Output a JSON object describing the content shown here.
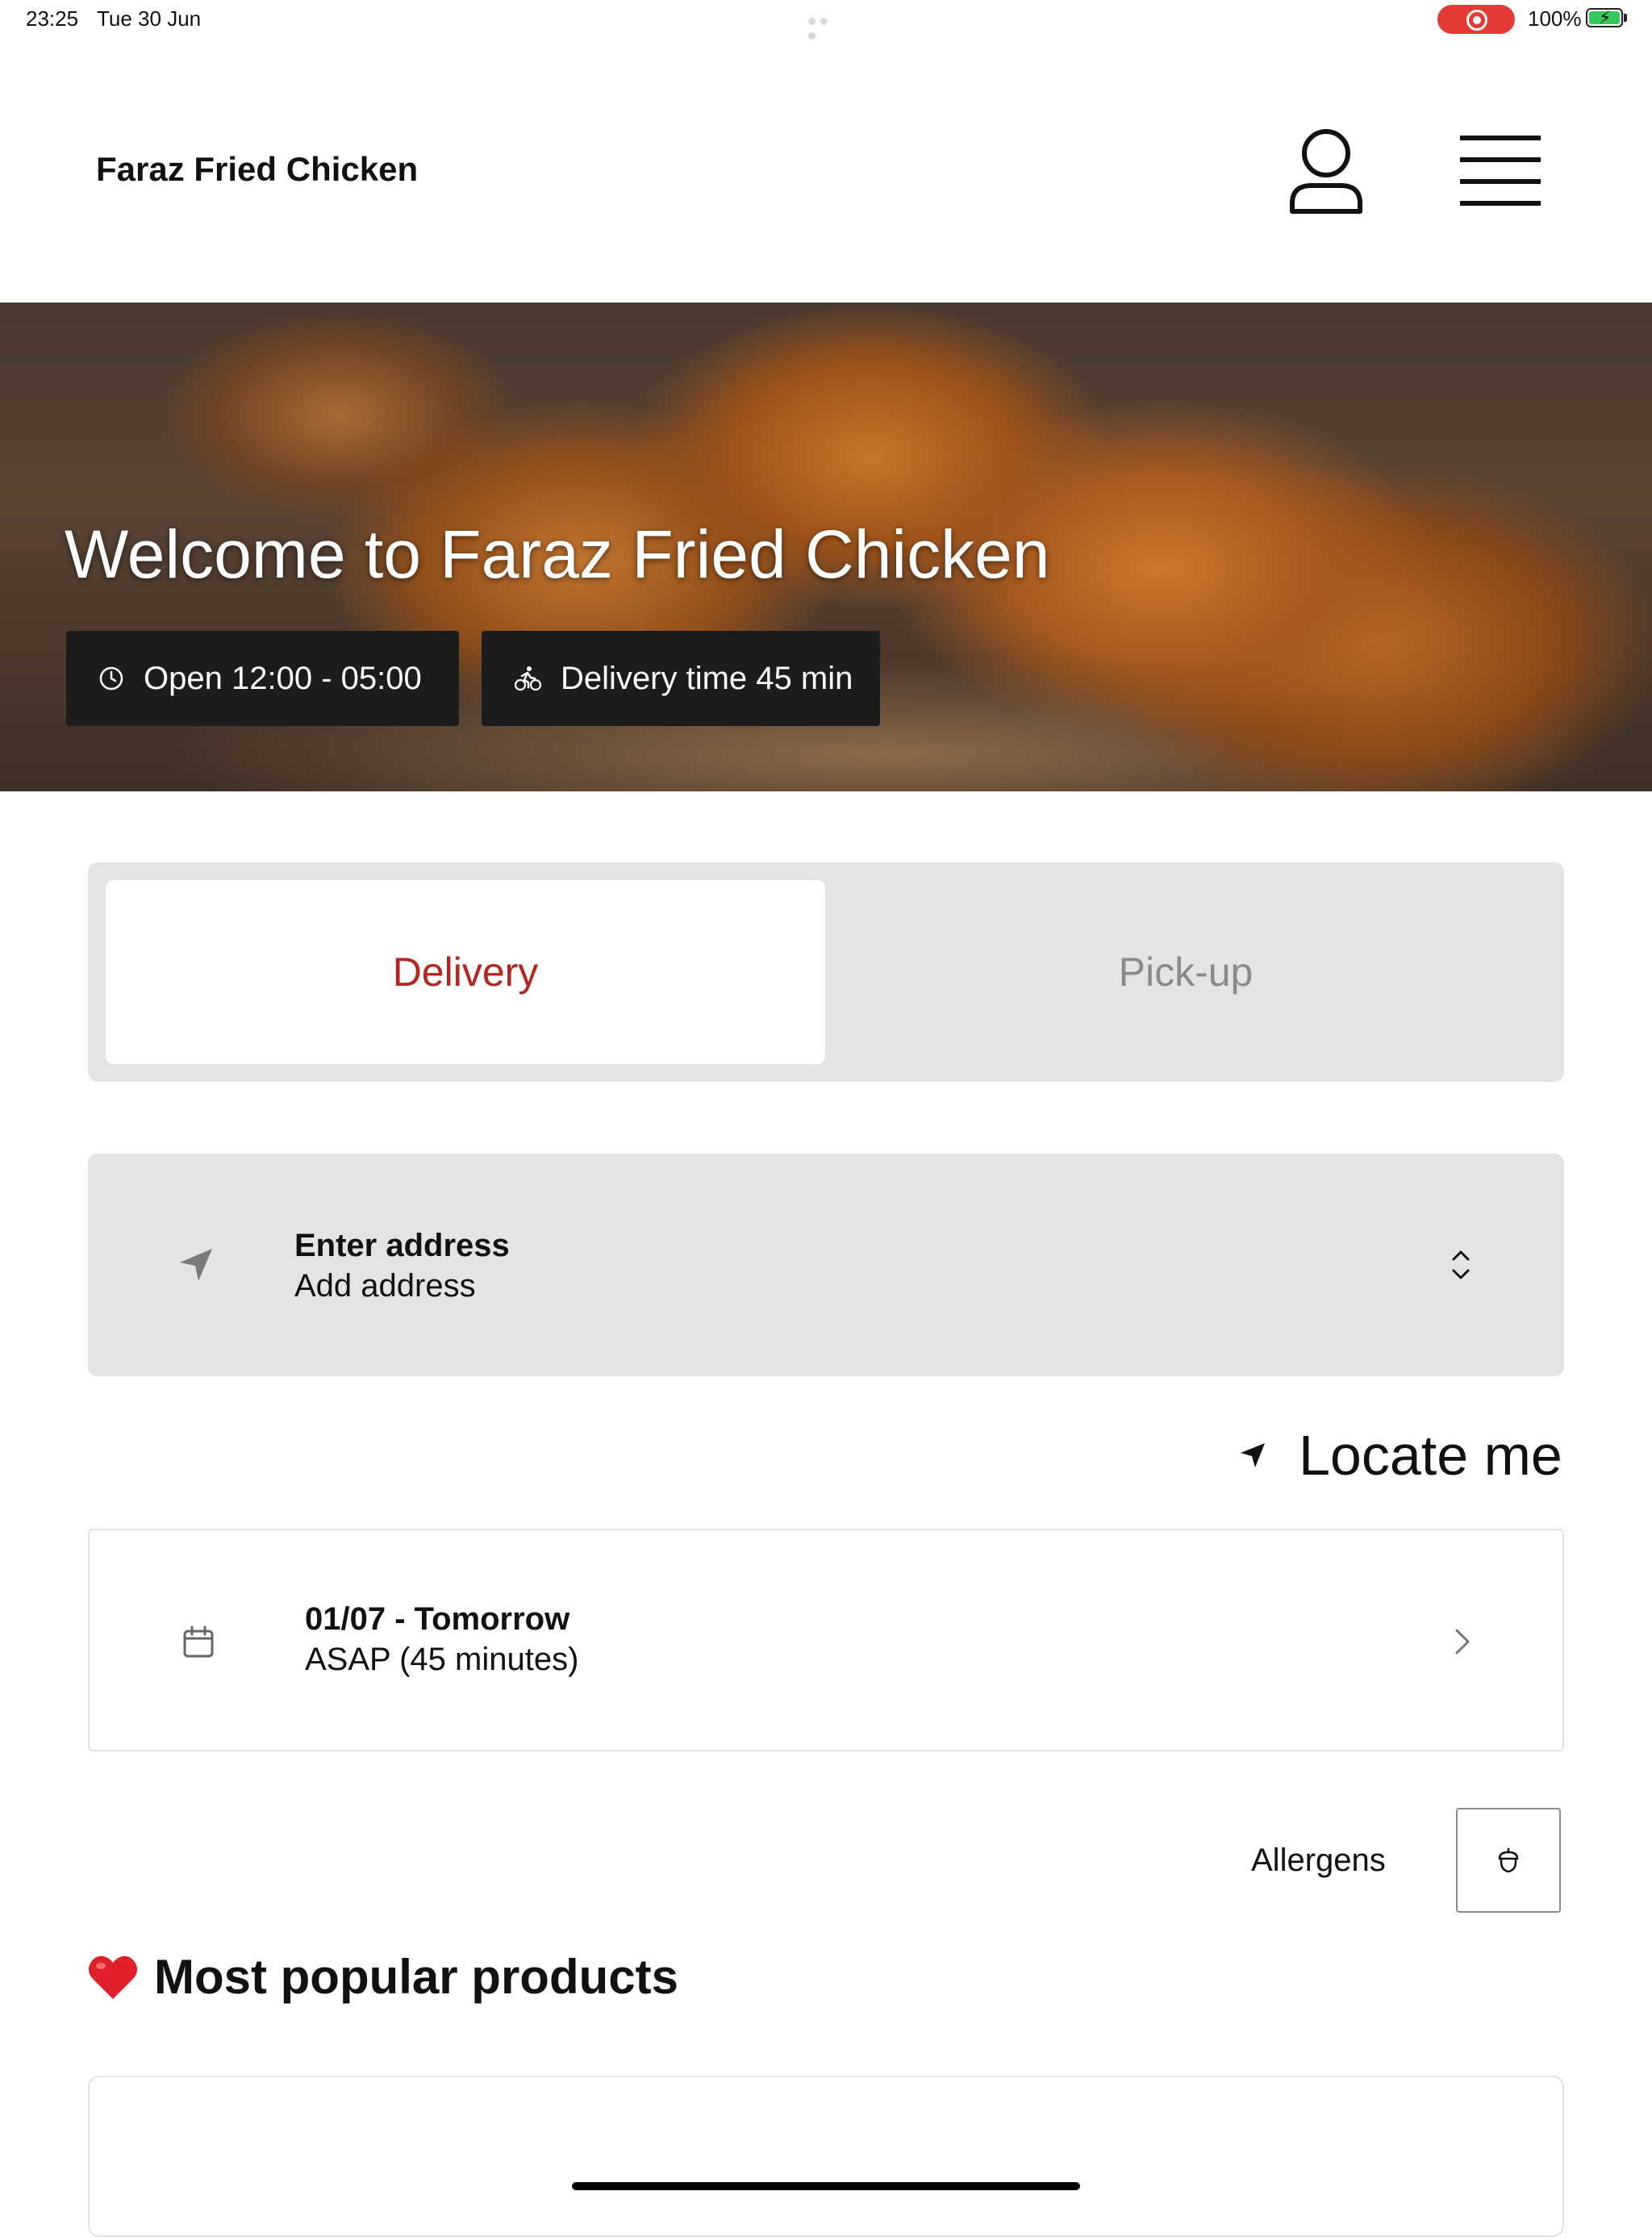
{
  "status_bar": {
    "time": "23:25",
    "date": "Tue 30 Jun",
    "battery_percent": "100%",
    "recording_color": "#e53935",
    "battery_color": "#34c759"
  },
  "header": {
    "brand": "Faraz Fried Chicken",
    "user_icon": "user-icon",
    "menu_icon": "hamburger-menu-icon"
  },
  "hero": {
    "title": "Welcome to Faraz Fried Chicken",
    "open_hours": "Open 12:00 - 05:00",
    "delivery_time": "Delivery time 45 min",
    "open_icon": "clock-icon",
    "delivery_icon": "cyclist-icon"
  },
  "order_mode": {
    "options": [
      "Delivery",
      "Pick-up"
    ],
    "selected": "Delivery",
    "active_color": "#b3261e"
  },
  "address": {
    "title": "Enter address",
    "placeholder": "Add address",
    "icon": "location-arrow-icon"
  },
  "locate": {
    "label": "Locate me",
    "icon": "location-arrow-icon"
  },
  "schedule": {
    "date": "01/07 - Tomorrow",
    "time": "ASAP (45 minutes)",
    "icon": "calendar-icon"
  },
  "allergens": {
    "label": "Allergens",
    "icon": "acorn-icon"
  },
  "popular": {
    "emoji": "❤️",
    "title": "Most popular products"
  }
}
